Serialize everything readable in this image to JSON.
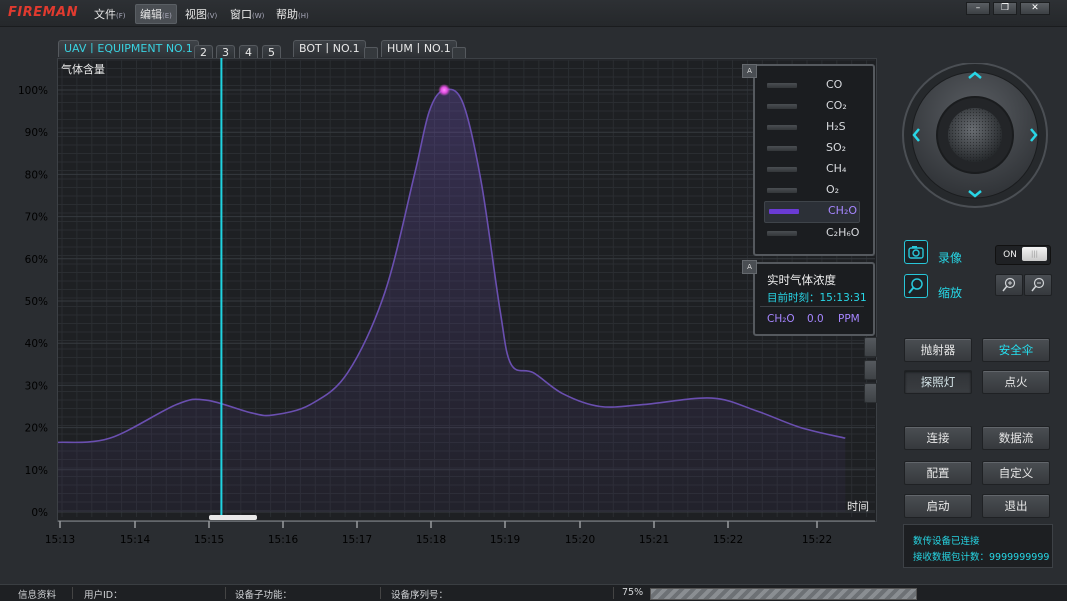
{
  "app": {
    "logo": "FIREMAN"
  },
  "menu": [
    {
      "label": "文件",
      "key": "(F)"
    },
    {
      "label": "编辑",
      "key": "(E)"
    },
    {
      "label": "视图",
      "key": "(V)"
    },
    {
      "label": "窗口",
      "key": "(W)"
    },
    {
      "label": "帮助",
      "key": "(H)"
    }
  ],
  "window_controls": {
    "minimize": "–",
    "restore": "❐",
    "close": "✕"
  },
  "tabs": {
    "uav": "UAV丨EQUIPMENT NO.1",
    "numbers": [
      "2",
      "3",
      "4",
      "5"
    ],
    "bot": "BOT丨NO.1",
    "hum": "HUM丨NO.1"
  },
  "chart_data": {
    "type": "area",
    "title": "气体含量",
    "xlabel": "时间",
    "ylabel": "",
    "x_ticks": [
      "15:13",
      "15:14",
      "15:15",
      "15:16",
      "15:17",
      "15:18",
      "15:19",
      "15:20",
      "15:21",
      "15:22",
      "15:22"
    ],
    "y_ticks": [
      "100%",
      "90%",
      "80%",
      "70%",
      "60%",
      "50%",
      "40%",
      "30%",
      "20%",
      "10%",
      "0%"
    ],
    "ylim": [
      0,
      100
    ],
    "grid": true,
    "cursor_x": 15.2,
    "series": [
      {
        "name": "CH₂O",
        "color": "#6a4fb0",
        "points": [
          [
            13.0,
            16.5
          ],
          [
            13.7,
            17.5
          ],
          [
            14.6,
            25.5
          ],
          [
            15.0,
            26.5
          ],
          [
            15.6,
            23.5
          ],
          [
            15.9,
            23
          ],
          [
            16.4,
            25.5
          ],
          [
            16.9,
            33
          ],
          [
            17.4,
            52
          ],
          [
            17.8,
            80
          ],
          [
            18.0,
            95
          ],
          [
            18.2,
            100
          ],
          [
            18.45,
            97
          ],
          [
            18.7,
            78
          ],
          [
            18.95,
            48
          ],
          [
            19.1,
            35
          ],
          [
            19.4,
            33
          ],
          [
            19.8,
            28
          ],
          [
            20.3,
            25
          ],
          [
            20.9,
            25.5
          ],
          [
            21.8,
            27
          ],
          [
            22.4,
            24
          ],
          [
            23.0,
            20
          ],
          [
            23.6,
            17.5
          ]
        ],
        "peak": [
          18.2,
          100
        ]
      }
    ]
  },
  "legend": {
    "pin": "A",
    "items": [
      {
        "name": "CO",
        "selected": false
      },
      {
        "name": "CO₂",
        "selected": false
      },
      {
        "name": "H₂S",
        "selected": false
      },
      {
        "name": "SO₂",
        "selected": false
      },
      {
        "name": "CH₄",
        "selected": false
      },
      {
        "name": "O₂",
        "selected": false
      },
      {
        "name": "CH₂O",
        "selected": true
      },
      {
        "name": "C₂H₆O",
        "selected": false
      }
    ]
  },
  "realtime": {
    "pin": "A",
    "title": "实时气体浓度",
    "time_label": "目前时刻：15:13:31",
    "gas": "CH₂O",
    "value": "0.0",
    "unit": "PPM"
  },
  "controls": {
    "record_label": "录像",
    "zoom_label": "缩放",
    "toggle_on": "ON",
    "toggle_off": "|||",
    "buttons": [
      "抛射器",
      "安全伞",
      "探照灯",
      "点火",
      "连接",
      "数据流",
      "配置",
      "自定义",
      "启动",
      "退出"
    ]
  },
  "status": {
    "line1": "数传设备已连接",
    "line2": "接收数据包计数：9999999999"
  },
  "statusbar": {
    "info": "信息资料",
    "user_id": "用户ID：",
    "sub_function": "设备子功能：",
    "serial": "设备序列号：",
    "progress": "75%",
    "progress_value": 0.75
  },
  "colors": {
    "accent": "#26d7e6",
    "series": "#6a4fb0",
    "selected_gas": "#a686ff"
  }
}
